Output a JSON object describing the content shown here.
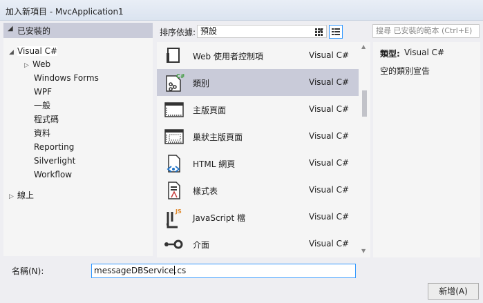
{
  "window": {
    "title": "加入新項目 - MvcApplication1"
  },
  "left_pane": {
    "header": "已安裝的",
    "tree": [
      {
        "label": "Visual C#",
        "twisty": "◢"
      },
      {
        "label": "Web",
        "twisty": "▷"
      },
      {
        "label": "Windows Forms",
        "twisty": ""
      },
      {
        "label": "WPF",
        "twisty": ""
      },
      {
        "label": "一般",
        "twisty": ""
      },
      {
        "label": "程式碼",
        "twisty": ""
      },
      {
        "label": "資料",
        "twisty": ""
      },
      {
        "label": "Reporting",
        "twisty": ""
      },
      {
        "label": "Silverlight",
        "twisty": ""
      },
      {
        "label": "Workflow",
        "twisty": ""
      },
      {
        "label": "線上",
        "twisty": "▷"
      }
    ]
  },
  "toolbar": {
    "sort_label": "排序依據:",
    "sort_value": "預設",
    "search_placeholder": "搜尋 已安裝的範本 (Ctrl+E)"
  },
  "templates": [
    {
      "name": "Web 使用者控制項",
      "lang": "Visual C#",
      "icon": "web-user-control-icon"
    },
    {
      "name": "類別",
      "lang": "Visual C#",
      "icon": "class-icon",
      "selected": true
    },
    {
      "name": "主版頁面",
      "lang": "Visual C#",
      "icon": "master-page-icon"
    },
    {
      "name": "巢狀主版頁面",
      "lang": "Visual C#",
      "icon": "nested-master-page-icon"
    },
    {
      "name": "HTML 網頁",
      "lang": "Visual C#",
      "icon": "html-page-icon"
    },
    {
      "name": "樣式表",
      "lang": "Visual C#",
      "icon": "stylesheet-icon"
    },
    {
      "name": "JavaScript 檔",
      "lang": "Visual C#",
      "icon": "javascript-file-icon"
    },
    {
      "name": "介面",
      "lang": "Visual C#",
      "icon": "interface-icon"
    }
  ],
  "details": {
    "type_label": "類型:",
    "type_value": "Visual C#",
    "description": "空的類別宣告"
  },
  "name_field": {
    "label": "名稱(N):",
    "value_before_caret": "messageDBService",
    "value_after_caret": ".cs"
  },
  "buttons": {
    "add": "新增(A)"
  },
  "colors": {
    "selection": "#c9cbd9",
    "focus_border": "#3399ff",
    "panel": "#f5f5f5"
  }
}
